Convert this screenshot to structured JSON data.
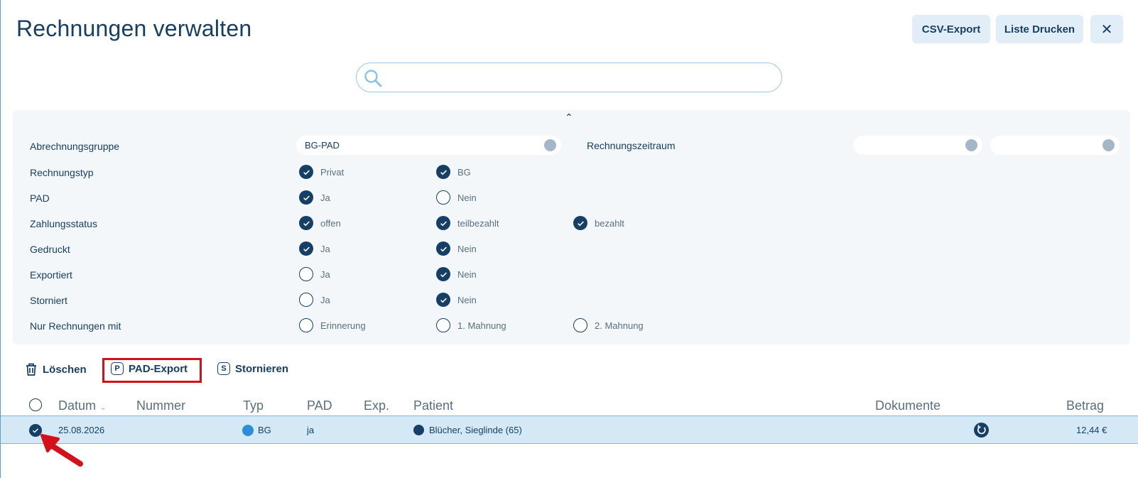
{
  "header": {
    "title": "Rechnungen verwalten",
    "csv_export": "CSV-Export",
    "print_list": "Liste Drucken",
    "close_symbol": "✕"
  },
  "search": {
    "value": "",
    "placeholder": ""
  },
  "filters": {
    "collapse_symbol": "⌃",
    "abrechnungsgruppe": {
      "label": "Abrechnungsgruppe",
      "value": "BG-PAD"
    },
    "rechnungszeitraum": {
      "label": "Rechnungszeitraum",
      "from": "",
      "to": ""
    },
    "rechnungstyp": {
      "label": "Rechnungstyp",
      "options": [
        {
          "label": "Privat",
          "checked": true
        },
        {
          "label": "BG",
          "checked": true
        }
      ]
    },
    "pad": {
      "label": "PAD",
      "options": [
        {
          "label": "Ja",
          "checked": true
        },
        {
          "label": "Nein",
          "checked": false
        }
      ]
    },
    "zahlungsstatus": {
      "label": "Zahlungsstatus",
      "options": [
        {
          "label": "offen",
          "checked": true
        },
        {
          "label": "teilbezahlt",
          "checked": true
        },
        {
          "label": "bezahlt",
          "checked": true
        }
      ]
    },
    "gedruckt": {
      "label": "Gedruckt",
      "options": [
        {
          "label": "Ja",
          "checked": true
        },
        {
          "label": "Nein",
          "checked": true
        }
      ]
    },
    "exportiert": {
      "label": "Exportiert",
      "options": [
        {
          "label": "Ja",
          "checked": false
        },
        {
          "label": "Nein",
          "checked": true
        }
      ]
    },
    "storniert": {
      "label": "Storniert",
      "options": [
        {
          "label": "Ja",
          "checked": false
        },
        {
          "label": "Nein",
          "checked": true
        }
      ]
    },
    "nur_rechnungen_mit": {
      "label": "Nur Rechnungen mit",
      "options": [
        {
          "label": "Erinnerung",
          "checked": false
        },
        {
          "label": "1. Mahnung",
          "checked": false
        },
        {
          "label": "2. Mahnung",
          "checked": false
        }
      ]
    }
  },
  "actions": {
    "delete": "Löschen",
    "pad_export": "PAD-Export",
    "pad_badge": "P",
    "cancel": "Stornieren",
    "cancel_badge": "S"
  },
  "table": {
    "columns": {
      "datum": "Datum",
      "nummer": "Nummer",
      "typ": "Typ",
      "pad": "PAD",
      "exp": "Exp.",
      "patient": "Patient",
      "dokumente": "Dokumente",
      "betrag": "Betrag"
    },
    "rows": [
      {
        "selected": true,
        "datum": "25.08.2026",
        "nummer": "",
        "typ": "BG",
        "pad": "ja",
        "exp": "",
        "patient": "Blücher, Sieglinde (65)",
        "betrag": "12,44 €"
      }
    ]
  },
  "colors": {
    "primary": "#163f66",
    "accent": "#d4111b",
    "row_highlight": "#d4e9f5",
    "type_dot": "#2a8fd8"
  }
}
